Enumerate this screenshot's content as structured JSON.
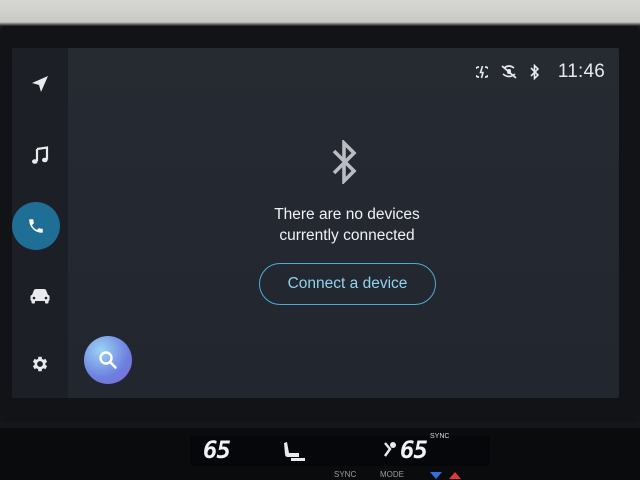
{
  "sidebar": {
    "items": [
      {
        "icon": "navigation-arrow-icon"
      },
      {
        "icon": "music-note-icon"
      },
      {
        "icon": "phone-icon",
        "active": true
      },
      {
        "icon": "car-icon"
      },
      {
        "icon": "gear-icon"
      }
    ],
    "active_color": "#1f6e96"
  },
  "status_bar": {
    "icons": [
      "wireless-charging-icon",
      "mic-muted-icon",
      "bluetooth-icon"
    ],
    "time": "11:46"
  },
  "main": {
    "icon": "bluetooth-icon",
    "message_line1": "There are no devices",
    "message_line2": "currently connected",
    "connect_button": "Connect a device",
    "accent": "#4aaed3"
  },
  "search_button": {
    "icon": "search-icon"
  },
  "climate": {
    "left_temp": "65",
    "right_temp": "65",
    "sync_tag": "SYNC",
    "labels": [
      "SYNC",
      "MODE"
    ]
  }
}
